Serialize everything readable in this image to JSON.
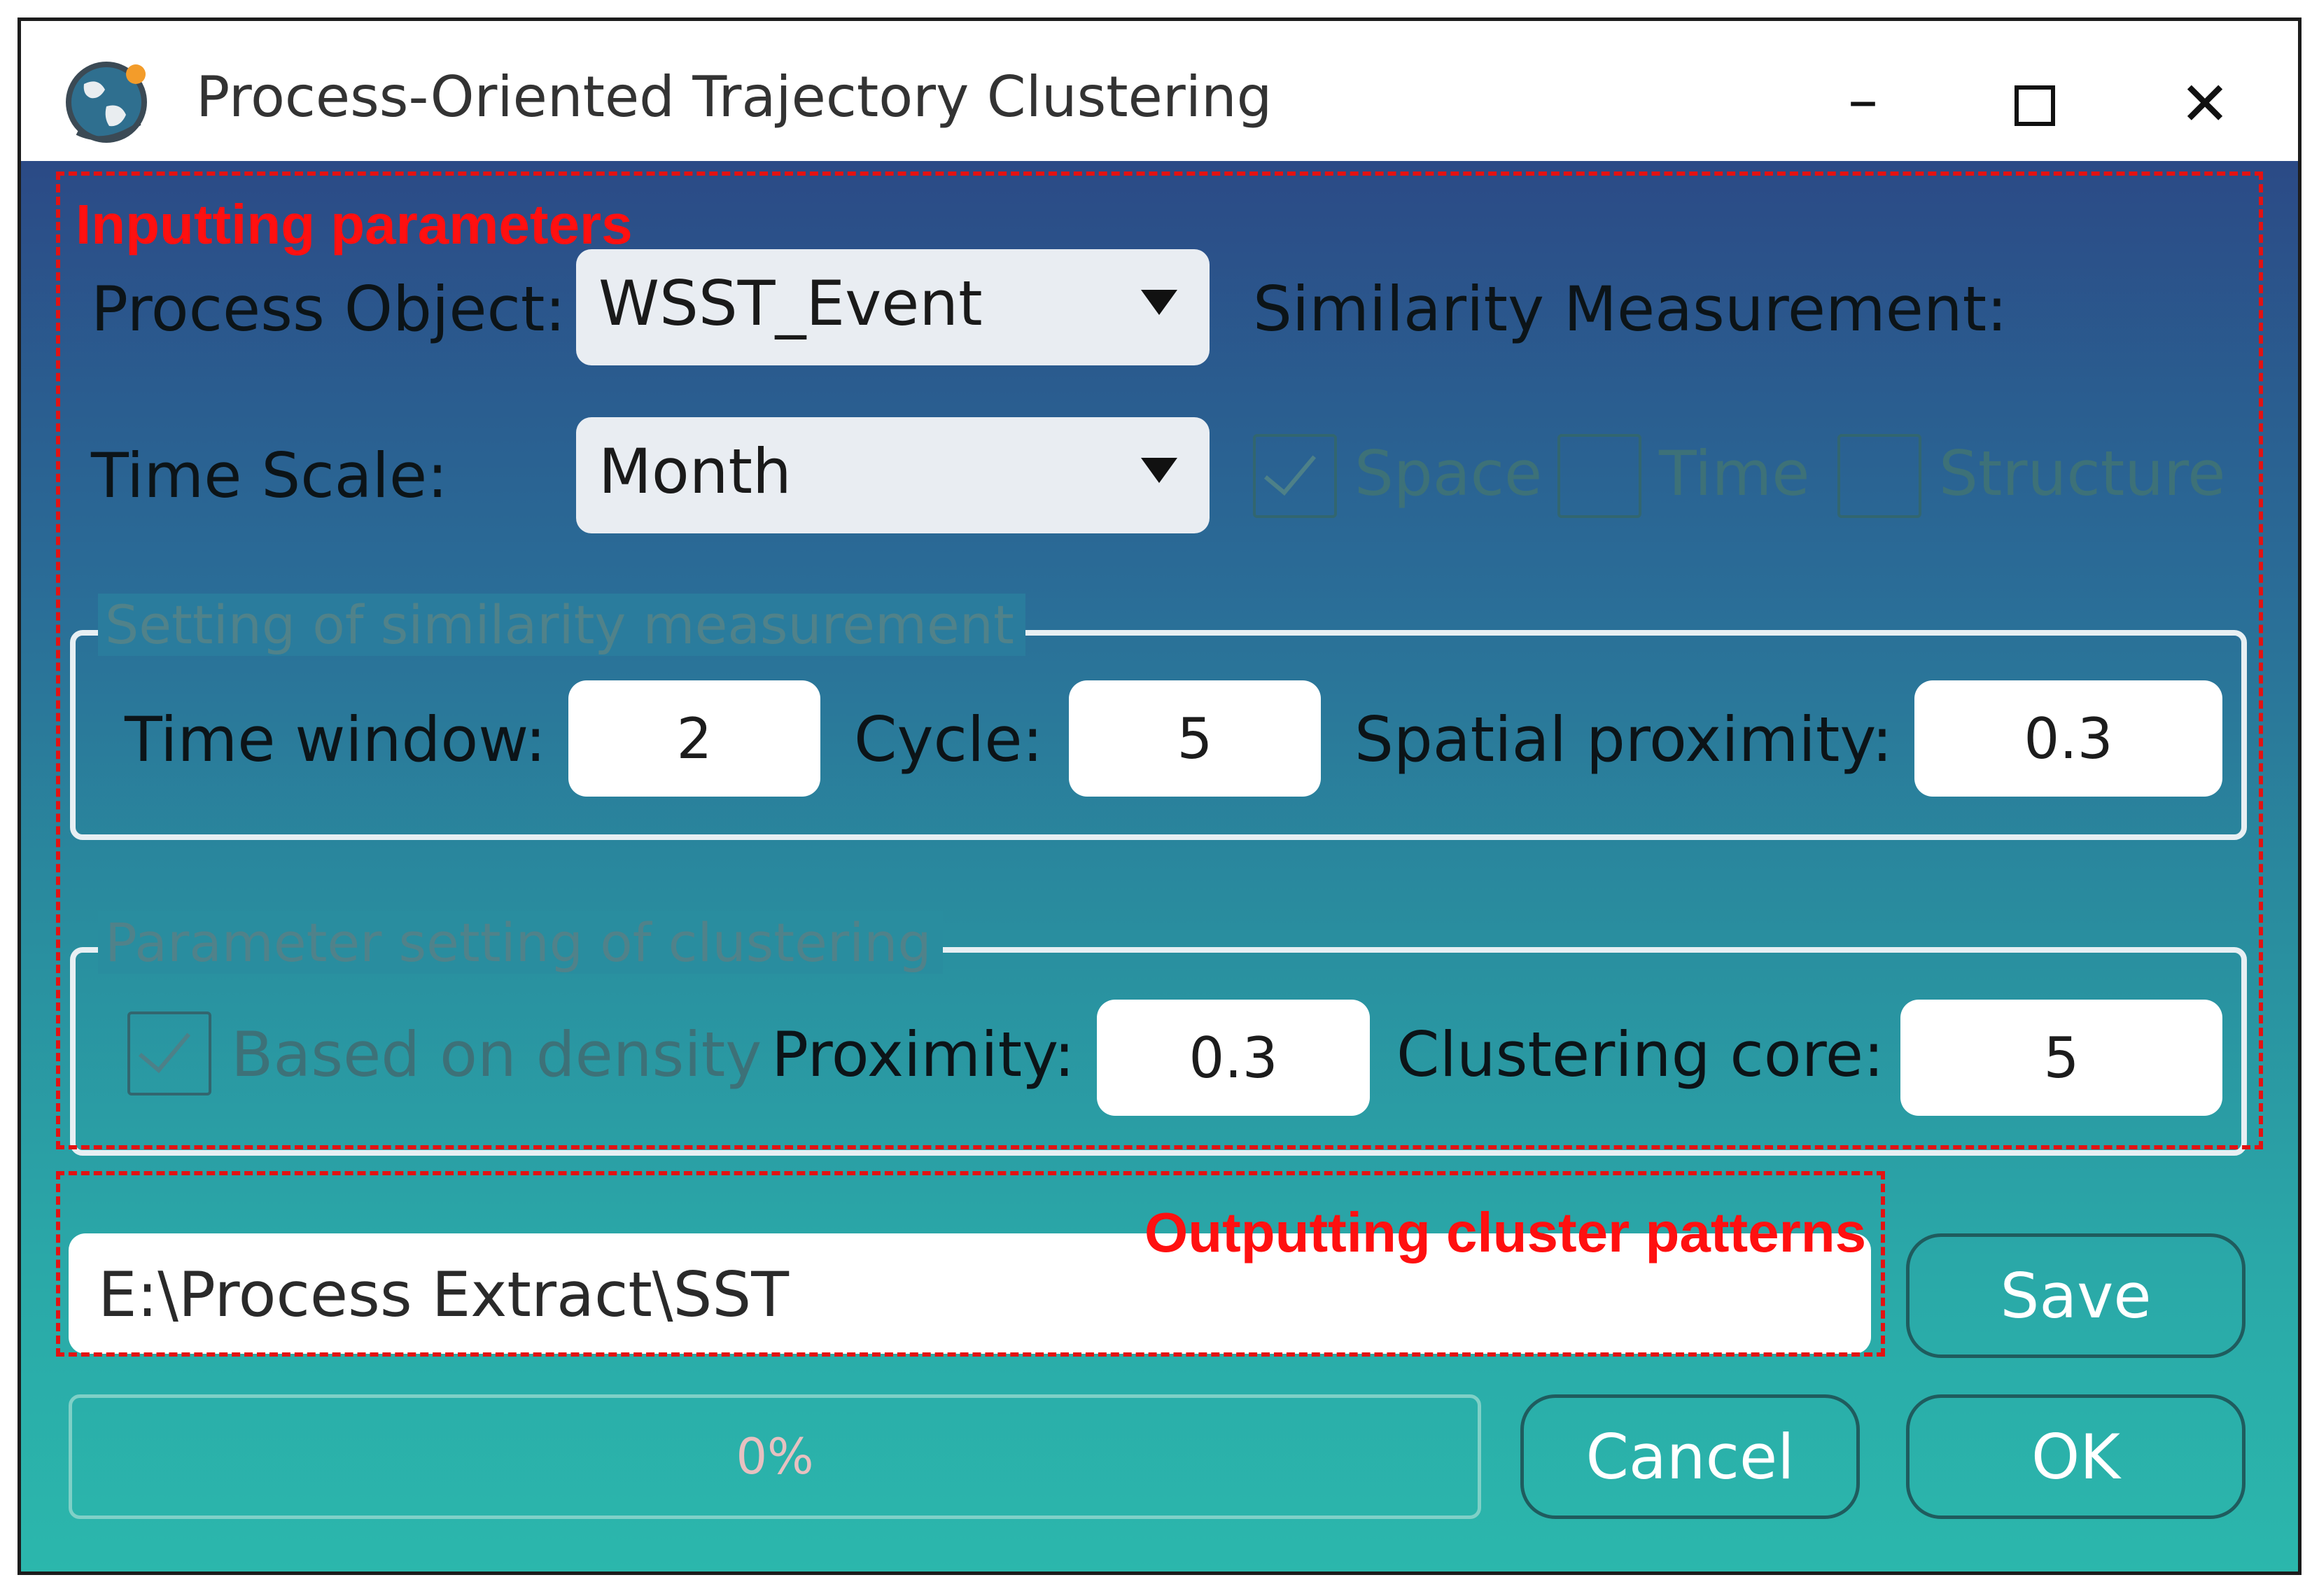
{
  "window": {
    "title": "Process-Oriented Trajectory Clustering",
    "minimize_glyph": "–",
    "maximize_glyph": "☐",
    "close_glyph": "✕",
    "app_icon": "globe-icon"
  },
  "annotations": {
    "input_label": "Inputting parameters",
    "output_label": "Outputting cluster patterns",
    "color": "#e31212"
  },
  "params": {
    "process_object_label": "Process Object:",
    "process_object_value": "WSST_Event",
    "time_scale_label": "Time Scale:",
    "time_scale_value": "Month",
    "similarity_label": "Similarity Measurement:",
    "checks": [
      {
        "label": "Space",
        "checked": true
      },
      {
        "label": "Time",
        "checked": false
      },
      {
        "label": "Structure",
        "checked": false
      }
    ]
  },
  "similarity_group": {
    "title": "Setting of similarity measurement",
    "time_window_label": "Time window:",
    "time_window_value": "2",
    "cycle_label": "Cycle:",
    "cycle_value": "5",
    "spatial_label": "Spatial proximity:",
    "spatial_value": "0.3"
  },
  "clustering_group": {
    "title": "Parameter setting of clustering",
    "density_label": "Based on density",
    "density_checked": true,
    "proximity_label": "Proximity:",
    "proximity_value": "0.3",
    "core_label": "Clustering core:",
    "core_value": "5"
  },
  "output": {
    "path": "E:\\Process Extract\\SST",
    "save_label": "Save"
  },
  "footer": {
    "progress_text": "0%",
    "progress": 0,
    "cancel_label": "Cancel",
    "ok_label": "OK"
  }
}
